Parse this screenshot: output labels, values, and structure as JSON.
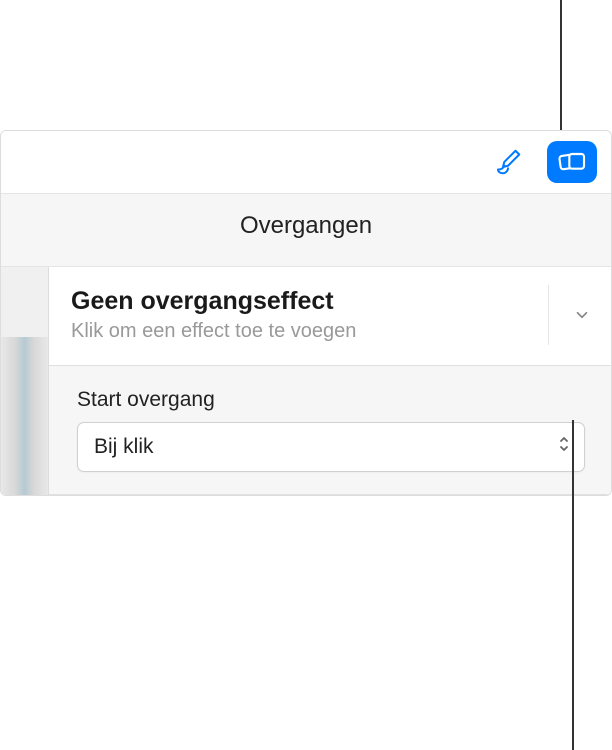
{
  "header": {
    "title": "Overgangen"
  },
  "toolbar": {
    "format_icon": "paintbrush-icon",
    "animate_icon": "animate-icon"
  },
  "effect": {
    "title": "Geen overgangseffect",
    "subtitle": "Klik om een effect toe te voegen"
  },
  "start": {
    "label": "Start overgang",
    "selected": "Bij klik"
  }
}
